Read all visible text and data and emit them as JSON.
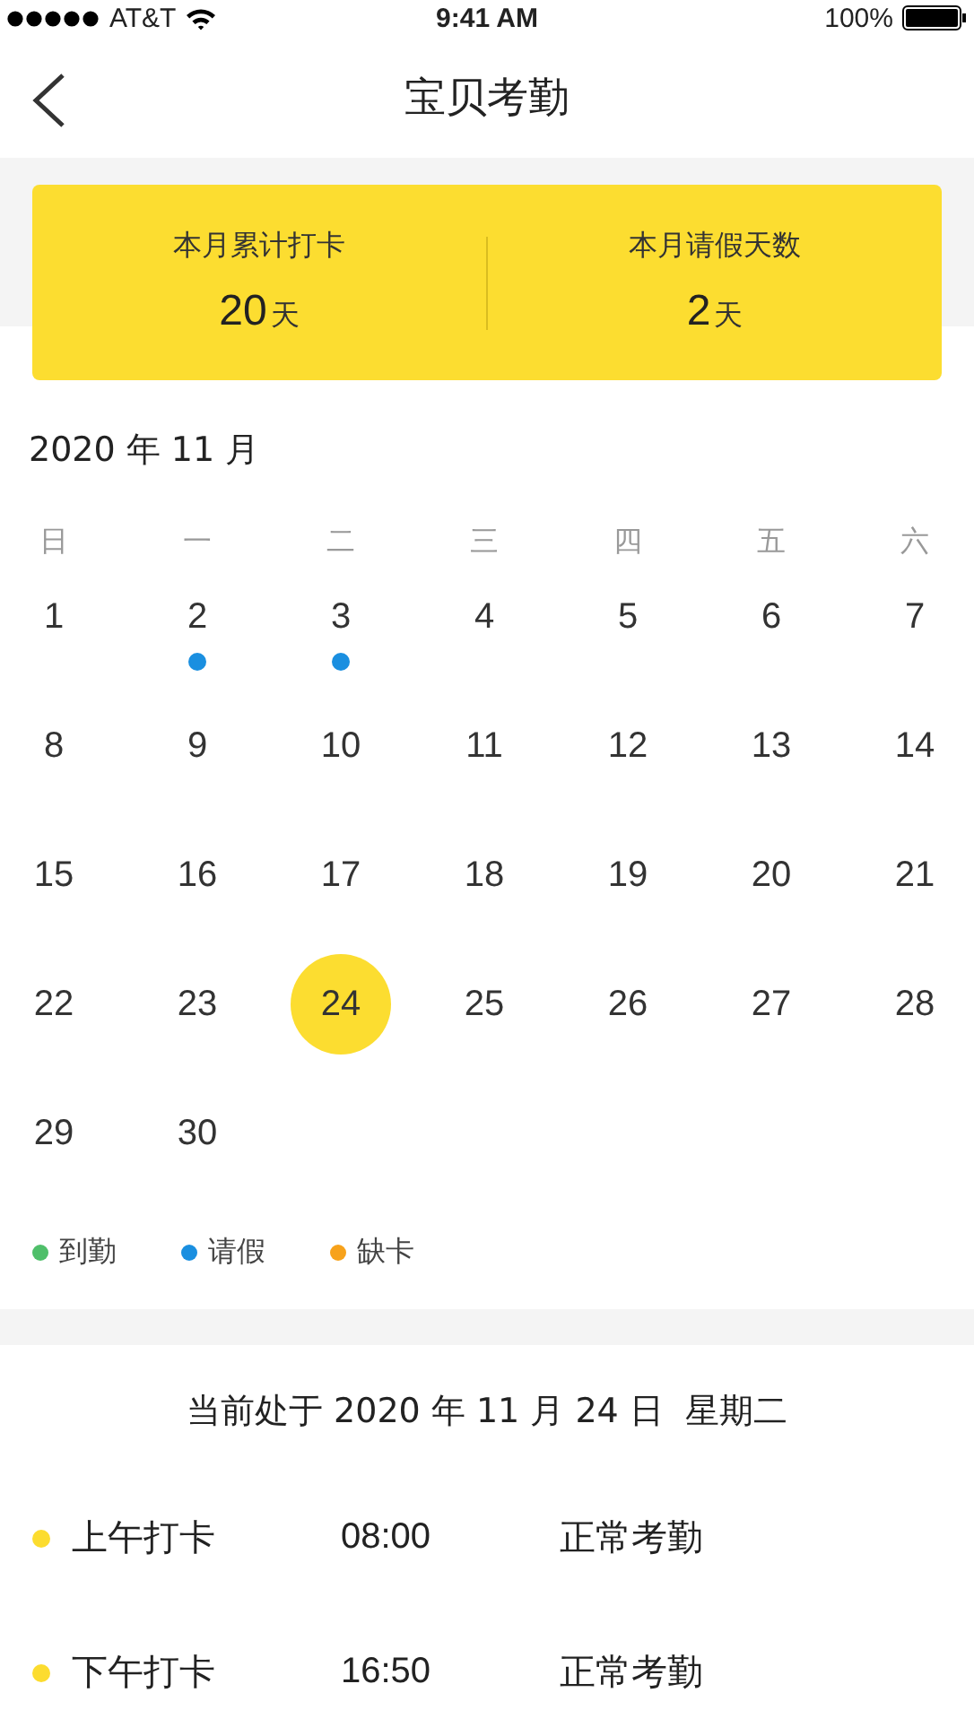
{
  "status_bar": {
    "carrier": "AT&T",
    "time": "9:41 AM",
    "battery": "100%"
  },
  "nav": {
    "title": "宝贝考勤"
  },
  "summary": [
    {
      "label": "本月累计打卡",
      "value": "20",
      "unit": "天"
    },
    {
      "label": "本月请假天数",
      "value": "2",
      "unit": "天"
    }
  ],
  "calendar": {
    "title": "2020 年 11 月",
    "weekdays": [
      "日",
      "一",
      "二",
      "三",
      "四",
      "五",
      "六"
    ],
    "days": [
      {
        "label": "1",
        "selected": false
      },
      {
        "label": "2",
        "selected": false,
        "color": "#1a8fe0"
      },
      {
        "label": "3",
        "selected": false,
        "color": "#1a8fe0"
      },
      {
        "label": "4",
        "selected": false
      },
      {
        "label": "5",
        "selected": false
      },
      {
        "label": "6",
        "selected": false
      },
      {
        "label": "7",
        "selected": false
      },
      {
        "label": "8",
        "selected": false
      },
      {
        "label": "9",
        "selected": false
      },
      {
        "label": "10",
        "selected": false
      },
      {
        "label": "11",
        "selected": false
      },
      {
        "label": "12",
        "selected": false
      },
      {
        "label": "13",
        "selected": false
      },
      {
        "label": "14",
        "selected": false
      },
      {
        "label": "15",
        "selected": false
      },
      {
        "label": "16",
        "selected": false
      },
      {
        "label": "17",
        "selected": false
      },
      {
        "label": "18",
        "selected": false
      },
      {
        "label": "19",
        "selected": false
      },
      {
        "label": "20",
        "selected": false
      },
      {
        "label": "21",
        "selected": false
      },
      {
        "label": "22",
        "selected": false
      },
      {
        "label": "23",
        "selected": false
      },
      {
        "label": "24",
        "selected": true
      },
      {
        "label": "25",
        "selected": false
      },
      {
        "label": "26",
        "selected": false
      },
      {
        "label": "27",
        "selected": false
      },
      {
        "label": "28",
        "selected": false
      },
      {
        "label": "29",
        "selected": false
      },
      {
        "label": "30",
        "selected": false
      }
    ],
    "legend": [
      {
        "label": "到勤",
        "color": "#4fbf6a"
      },
      {
        "label": "请假",
        "color": "#1a8fe0"
      },
      {
        "label": "缺卡",
        "color": "#f7a21b"
      }
    ]
  },
  "today": {
    "text": "当前处于 2020 年 11 月 24 日  星期二",
    "records": [
      {
        "label": "上午打卡",
        "time": "08:00",
        "status": "正常考勤",
        "color": "#fcdc2f"
      },
      {
        "label": "下午打卡",
        "time": "16:50",
        "status": "正常考勤",
        "color": "#fcdc2f"
      }
    ]
  }
}
